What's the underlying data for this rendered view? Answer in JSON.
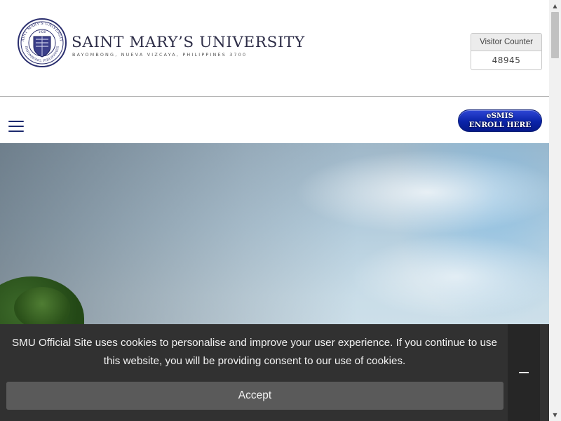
{
  "header": {
    "university_name": "SAINT MARY’S UNIVERSITY",
    "location": "BAYOMBONG, NUEVA VIZCAYA, PHILIPPINES 3700",
    "seal_text": "SAINT MARY'S UNIVERSITY",
    "seal_subtext": "BAYOMBONG, PHILIPPINES",
    "seal_year": "1928"
  },
  "visitor_counter": {
    "title": "Visitor Counter",
    "value": "48945"
  },
  "nav": {
    "menu_icon": "hamburger-icon",
    "enroll_line1": "eSMIS",
    "enroll_line2": "ENROLL HERE"
  },
  "cookie": {
    "message": "SMU Official Site uses cookies to personalise and improve your user experience. If you continue to use this website, you will be providing consent to our use of cookies.",
    "accept_label": "Accept",
    "close_label": "–"
  },
  "colors": {
    "brand_navy": "#1c2a6e",
    "enroll_blue": "#0a23a8",
    "banner_bg": "#313131",
    "accept_bg": "#5a5a5a"
  }
}
